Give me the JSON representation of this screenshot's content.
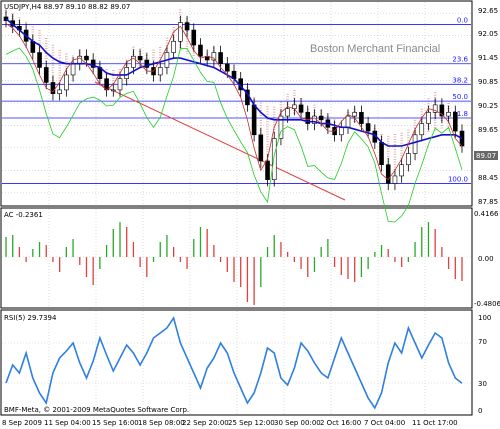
{
  "main": {
    "title": "USDJPY,H4  88.97 89.10 88.82 89.07",
    "watermark": "Boston Merchant Financial",
    "price_labels": [
      "92.65",
      "92.05",
      "91.45",
      "90.85",
      "90.25",
      "89.65",
      "89.07",
      "88.45",
      "87.85"
    ],
    "current_price": "89.07",
    "fib_levels": [
      "0.0",
      "23.6",
      "38.2",
      "50.0",
      "61.8",
      "100.0"
    ]
  },
  "ac": {
    "label": "AC -0.2361",
    "scale_labels": [
      "0.4166",
      "0.00",
      "-0.4806"
    ]
  },
  "rsi": {
    "label": "RSI(5) 29.7394",
    "scale_labels": [
      "100",
      "70",
      "30",
      "0"
    ]
  },
  "x_axis": [
    "8 Sep 2009",
    "11 Sep 04:00",
    "15 Sep 16:00",
    "18 Sep 08:00",
    "22 Sep 20:00",
    "25 Sep 12:00",
    "30 Sep 00:00",
    "2 Oct 16:00",
    "7 Oct 04:00",
    "11 Oct 17:00"
  ],
  "copyright": "BMF-Meta, © 2001-2009 MetaQuotes Software Corp.",
  "colors": {
    "background": "#ffffff",
    "grid": "#c8c8c8",
    "fib_line": "#1a1aff",
    "moving_average": "#1010cc",
    "ichimoku_cloud": "#d9a7a0",
    "chikou": "#22cc22",
    "trendline": "#e04040",
    "ac_up": "#2aa82a",
    "ac_down": "#e04040",
    "rsi_line": "#2f7fe0",
    "price_marker_bg": "#666666"
  },
  "chart_data": [
    {
      "type": "line",
      "title": "USDJPY,H4  88.97 89.10 88.82 89.07",
      "ylim": [
        87.55,
        92.95
      ],
      "y_ticks": [
        92.65,
        92.05,
        91.45,
        90.85,
        90.25,
        89.65,
        89.07,
        88.45,
        87.85
      ],
      "fibonacci": [
        {
          "label": "0.0",
          "price": 92.35
        },
        {
          "label": "23.6",
          "price": 91.3
        },
        {
          "label": "38.2",
          "price": 90.75
        },
        {
          "label": "50.0",
          "price": 90.3
        },
        {
          "label": "61.8",
          "price": 89.85
        },
        {
          "label": "100.0",
          "price": 88.1
        }
      ],
      "series": [
        {
          "values": [
            92.45,
            92.3,
            92.2,
            91.9,
            91.6,
            91.2,
            90.8,
            90.5,
            90.6,
            91.0,
            91.3,
            91.5,
            91.4,
            91.2,
            90.9,
            90.6,
            90.6,
            90.9,
            91.2,
            91.5,
            91.4,
            91.2,
            91.0,
            91.2,
            91.6,
            91.9,
            92.4,
            92.2,
            91.8,
            91.5,
            91.4,
            91.6,
            91.3,
            91.1,
            90.9,
            90.6,
            90.2,
            89.4,
            88.7,
            88.2,
            89.3,
            89.9,
            90.1,
            90.2,
            90.0,
            89.7,
            89.9,
            89.8,
            89.6,
            89.4,
            89.6,
            89.9,
            90.0,
            89.7,
            89.5,
            89.2,
            88.6,
            88.1,
            88.3,
            88.6,
            88.9,
            89.4,
            89.7,
            90.0,
            90.2,
            89.9,
            90.0,
            89.5,
            89.1
          ]
        },
        {
          "values": [
            92.5,
            92.35,
            92.2,
            92.05,
            91.9,
            91.8,
            91.6,
            91.45,
            91.35,
            91.3,
            91.3,
            91.3,
            91.3,
            91.25,
            91.2,
            91.05,
            91.0,
            91.0,
            91.0,
            91.1,
            91.2,
            91.25,
            91.3,
            91.35,
            91.4,
            91.45,
            91.45,
            91.4,
            91.35,
            91.3,
            91.25,
            91.2,
            91.1,
            91.0,
            90.9,
            90.7,
            90.5,
            90.2,
            90.0,
            89.85,
            89.8,
            89.8,
            89.8,
            89.8,
            89.8,
            89.75,
            89.75,
            89.7,
            89.7,
            89.65,
            89.6,
            89.6,
            89.55,
            89.5,
            89.45,
            89.4,
            89.2,
            89.1,
            89.1,
            89.1,
            89.15,
            89.2,
            89.25,
            89.3,
            89.35,
            89.4,
            89.4,
            89.4,
            89.3
          ]
        }
      ]
    },
    {
      "type": "bar",
      "title": "AC -0.2361",
      "ylim": [
        -0.4806,
        0.4166
      ],
      "values": [
        0.2,
        0.22,
        0.1,
        -0.05,
        0.08,
        0.15,
        0.12,
        -0.05,
        -0.15,
        0.1,
        0.18,
        -0.08,
        -0.2,
        -0.28,
        -0.12,
        0.12,
        0.28,
        0.35,
        0.3,
        0.15,
        -0.1,
        -0.2,
        -0.05,
        0.15,
        0.22,
        0.1,
        -0.05,
        -0.12,
        0.18,
        0.3,
        0.28,
        0.12,
        -0.05,
        -0.15,
        -0.25,
        -0.3,
        -0.45,
        -0.48,
        -0.3,
        0.1,
        0.22,
        0.15,
        0.05,
        -0.05,
        -0.12,
        -0.2,
        -0.15,
        0.1,
        0.18,
        -0.1,
        -0.18,
        -0.22,
        -0.25,
        -0.2,
        -0.12,
        0.05,
        0.12,
        0.08,
        -0.05,
        -0.1,
        -0.05,
        0.15,
        0.3,
        0.35,
        0.28,
        0.1,
        -0.12,
        -0.22,
        -0.24
      ]
    },
    {
      "type": "line",
      "title": "RSI(5) 29.7394",
      "ylim": [
        0,
        100
      ],
      "y_ticks": [
        100,
        70,
        30,
        0
      ],
      "values": [
        30,
        48,
        40,
        60,
        35,
        20,
        10,
        40,
        55,
        62,
        70,
        50,
        35,
        52,
        75,
        58,
        42,
        55,
        68,
        60,
        48,
        60,
        75,
        80,
        85,
        95,
        70,
        55,
        40,
        25,
        45,
        55,
        70,
        60,
        40,
        25,
        10,
        20,
        40,
        65,
        60,
        35,
        28,
        45,
        70,
        62,
        50,
        40,
        35,
        55,
        75,
        60,
        45,
        30,
        15,
        5,
        20,
        50,
        70,
        60,
        85,
        70,
        55,
        68,
        80,
        75,
        50,
        35,
        29.7
      ]
    }
  ]
}
